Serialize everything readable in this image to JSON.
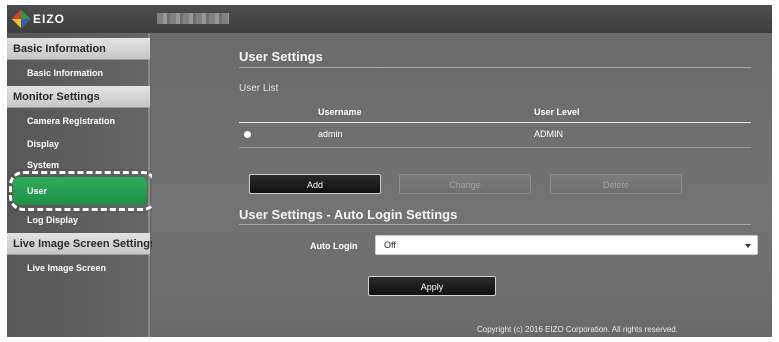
{
  "brand": {
    "logo_text": "EIZO"
  },
  "sidebar": {
    "sections": [
      {
        "header": "Basic Information",
        "items": [
          {
            "label": "Basic Information",
            "active": false
          }
        ]
      },
      {
        "header": "Monitor Settings",
        "items": [
          {
            "label": "Camera Registration",
            "active": false
          },
          {
            "label": "Display",
            "active": false
          },
          {
            "label": "System",
            "active": false
          },
          {
            "label": "User",
            "active": true
          },
          {
            "label": "Log Display",
            "active": false
          }
        ]
      },
      {
        "header": "Live Image Screen Settings",
        "items": [
          {
            "label": "Live Image Screen",
            "active": false
          }
        ]
      }
    ]
  },
  "main": {
    "user_settings": {
      "title": "User Settings",
      "list_title": "User List",
      "columns": [
        "Username",
        "User Level"
      ],
      "rows": [
        {
          "username": "admin",
          "user_level": "ADMIN",
          "selected": true
        }
      ],
      "buttons": {
        "add": "Add",
        "change": "Change",
        "delete": "Delete"
      }
    },
    "auto_login": {
      "title": "User Settings - Auto Login Settings",
      "label": "Auto Login",
      "value": "Off",
      "apply_label": "Apply"
    },
    "footer": "Copyright (c) 2016 EIZO Corporation. All rights reserved."
  },
  "colors": {
    "active_item": "#2aa657",
    "background": "#6b6b6b",
    "header_bg": "#d4d4d4"
  }
}
